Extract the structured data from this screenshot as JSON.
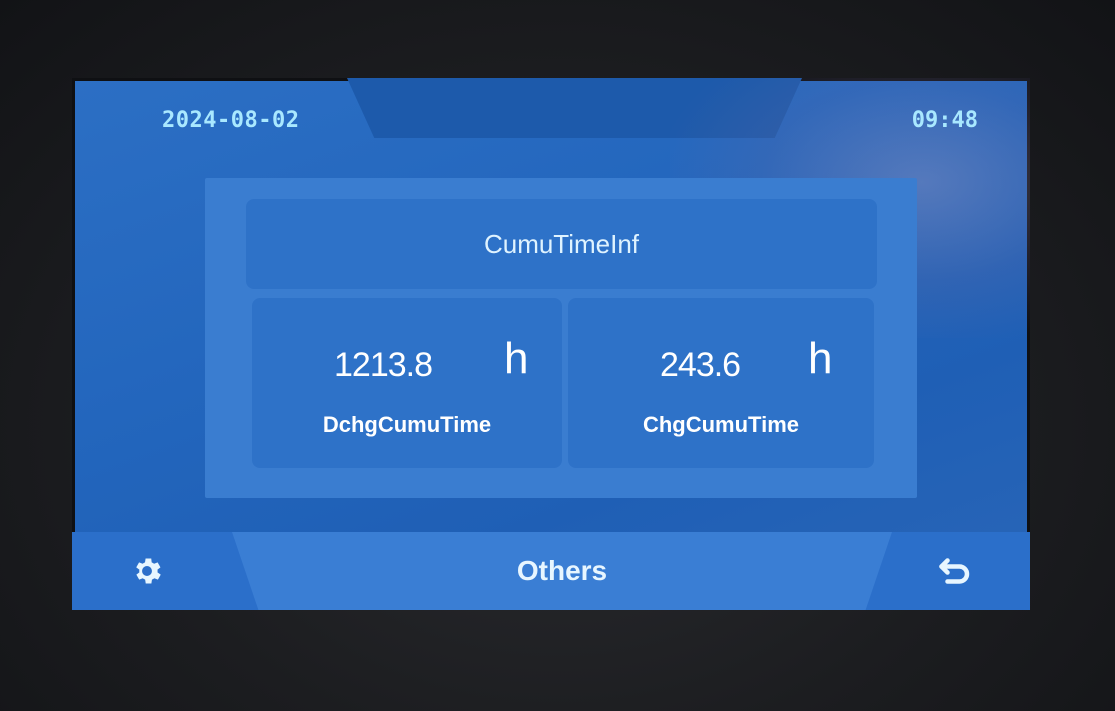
{
  "status_bar": {
    "date": "2024-08-02",
    "time": "09:48"
  },
  "panel": {
    "title": "CumuTimeInf",
    "discharge": {
      "value": "1213.8",
      "unit": "h",
      "label": "DchgCumuTime"
    },
    "charge": {
      "value": "243.6",
      "unit": "h",
      "label": "ChgCumuTime"
    }
  },
  "bottom_bar": {
    "left_icon": "gear-icon",
    "center_label": "Others",
    "right_icon": "back-arrow-icon"
  },
  "colors": {
    "screen_bg": "#2366bd",
    "panel_bg": "#3a7dd0",
    "card_bg": "#2e72c8",
    "header_text": "#a9e8ff",
    "text": "#ffffff"
  }
}
